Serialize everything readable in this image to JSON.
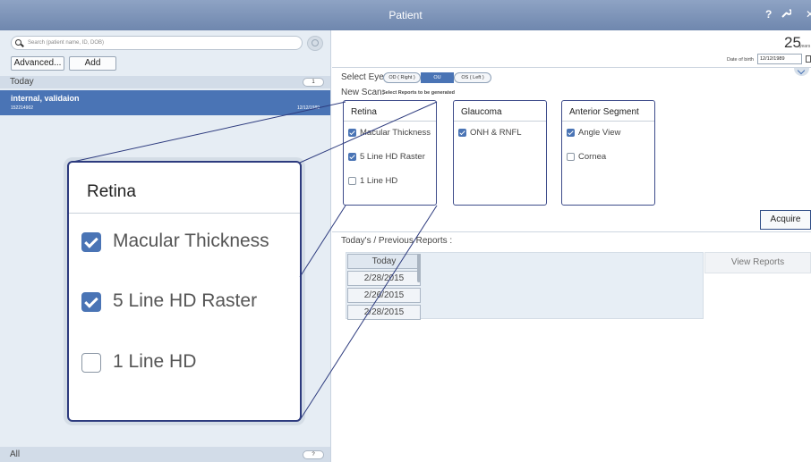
{
  "window": {
    "title": "Patient",
    "help": "?",
    "close": "✕"
  },
  "left": {
    "search_placeholder": "Search (patient name, ID, DOB)",
    "advanced_label": "Advanced...",
    "add_label": "Add",
    "today_label": "Today",
    "today_count": "1",
    "patient": {
      "name": "internal, validaion",
      "id": "152214902",
      "date": "12/12/1989"
    },
    "all_label": "All",
    "all_count": "?"
  },
  "right": {
    "age": "25",
    "age_unit": "years",
    "dob_label": "Date of birth",
    "dob_value": "12/12/1989",
    "select_eye_label": "Select Eye:",
    "eyes": [
      "OD ( Right )",
      "OU",
      "OS ( Left )"
    ],
    "selected_eye": "OU",
    "new_scan_label": "New Scan:",
    "new_scan_hint": "Select Reports to be generated",
    "scan_groups": [
      {
        "title": "Retina",
        "items": [
          {
            "label": "Macular Thickness",
            "checked": true
          },
          {
            "label": "5 Line HD Raster",
            "checked": true
          },
          {
            "label": "1 Line HD",
            "checked": false
          }
        ]
      },
      {
        "title": "Glaucoma",
        "items": [
          {
            "label": "ONH & RNFL",
            "checked": true
          }
        ]
      },
      {
        "title": "Anterior Segment",
        "items": [
          {
            "label": "Angle View",
            "checked": true
          },
          {
            "label": "Cornea",
            "checked": false
          }
        ]
      }
    ],
    "acquire_label": "Acquire",
    "reports_label": "Today's / Previous Reports :",
    "report_dates": [
      "Today",
      "2/28/2015",
      "2/26/2015",
      "2/28/2015"
    ],
    "view_reports_label": "View Reports"
  },
  "zoom": {
    "title": "Retina",
    "items": [
      {
        "label": "Macular Thickness",
        "checked": true
      },
      {
        "label": "5 Line HD Raster",
        "checked": true
      },
      {
        "label": "1 Line HD",
        "checked": false
      }
    ]
  },
  "colors": {
    "accent": "#4a74b5",
    "titlebar": "#7a90b6",
    "border_dark": "#2d3b7e"
  }
}
